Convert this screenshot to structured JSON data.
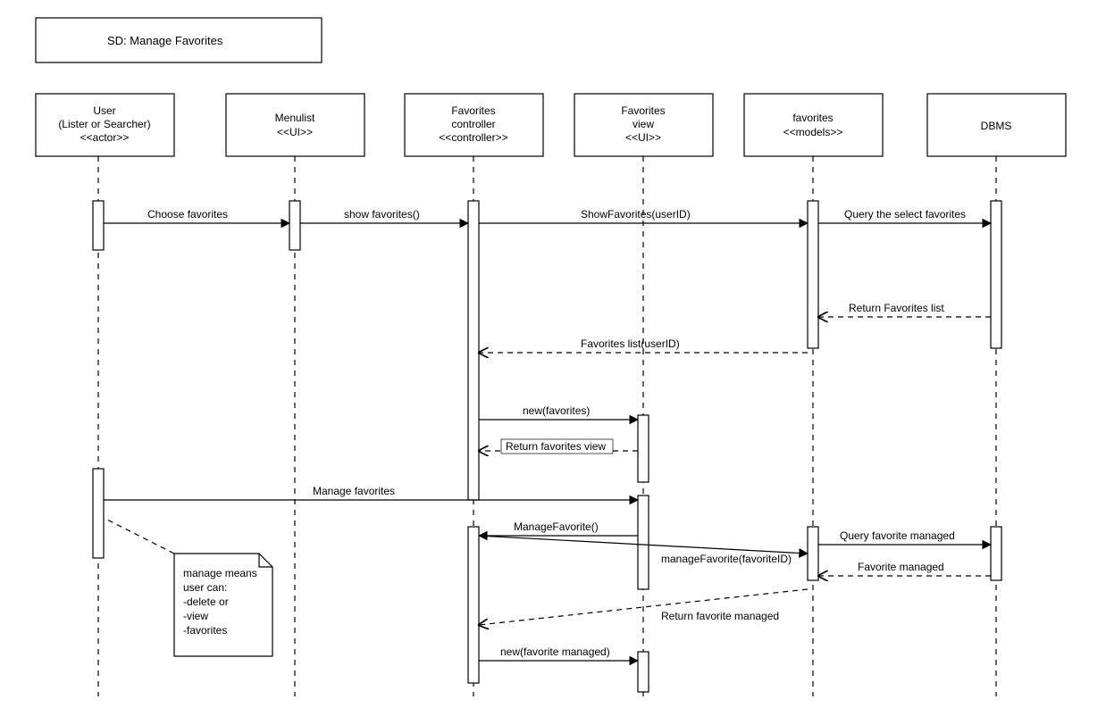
{
  "title": "SD: Manage Favorites",
  "lanes": {
    "user": {
      "l1": "User",
      "l2": "(Lister or Searcher)",
      "l3": "<<actor>>"
    },
    "menu": {
      "l1": "Menulist",
      "l2": "<<UI>>"
    },
    "ctrl": {
      "l1": "Favorites",
      "l2": "controller",
      "l3": "<<controller>>"
    },
    "view": {
      "l1": "Favorites",
      "l2": "view",
      "l3": "<<UI>>"
    },
    "model": {
      "l1": "favorites",
      "l2": "<<models>>"
    },
    "dbms": {
      "l1": "DBMS"
    }
  },
  "messages": {
    "m1": "Choose favorites",
    "m2": "show favorites()",
    "m3": "ShowFavorites(userID)",
    "m4": "Query the select favorites",
    "m5": "Return Favorites list",
    "m6": "Favorites list(userID)",
    "m7": "new(favorites)",
    "m8": "Return favorites view",
    "m9": "Manage favorites",
    "m10": "ManageFavorite()",
    "m11": "manageFavorite(favoriteID)",
    "m12": "Query favorite managed",
    "m13": "Favorite managed",
    "m14": "Return favorite managed",
    "m15": "new(favorite managed)"
  },
  "note": {
    "l1": "manage means",
    "l2": "user can:",
    "l3": "-delete or",
    "l4": "-view",
    "l5": "-favorites"
  }
}
